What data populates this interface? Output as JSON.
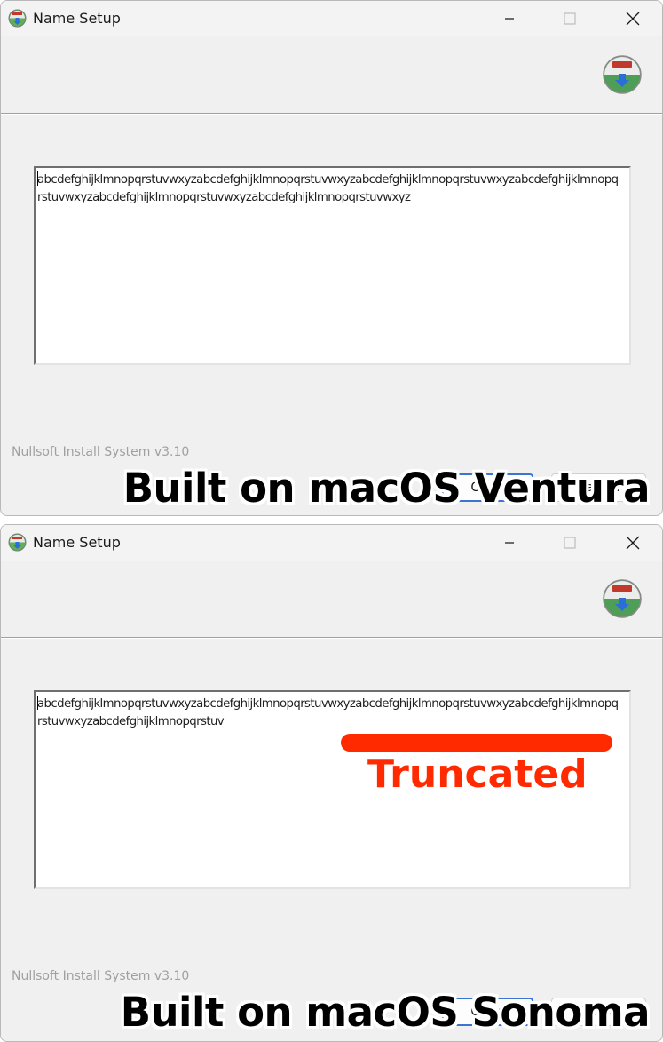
{
  "panels": [
    {
      "window_title": "Name Setup",
      "textbox_value": "abcdefghijklmnopqrstuvwxyzabcdefghijklmnopqrstuvwxyzabcdefghijklmnopqrstuvwxyzabcdefghijklmnopqrstuvwxyzabcdefghijklmnopqrstuvwxyzabcdefghijklmnopqrstuvwxyz",
      "branding": "Nullsoft Install System v3.10",
      "close_button_label": "Close",
      "cancel_button_label": "Cancel",
      "caption": "Built on macOS Ventura"
    },
    {
      "window_title": "Name Setup",
      "textbox_value": "abcdefghijklmnopqrstuvwxyzabcdefghijklmnopqrstuvwxyzabcdefghijklmnopqrstuvwxyzabcdefghijklmnopqrstuvwxyzabcdefghijklmnopqrstuv",
      "branding": "Nullsoft Install System v3.10",
      "close_button_label": "Close",
      "cancel_button_label": "Cancel",
      "caption": "Built on macOS Sonoma",
      "annotation_label": "Truncated"
    }
  ],
  "colors": {
    "annotation_red": "#ff2a00",
    "focus_blue": "#3b74d1"
  },
  "icons": {
    "app": "nsis-installer-icon",
    "header": "nsis-installer-icon",
    "minimize": "minimize-icon",
    "maximize": "maximize-icon",
    "close": "close-icon"
  }
}
